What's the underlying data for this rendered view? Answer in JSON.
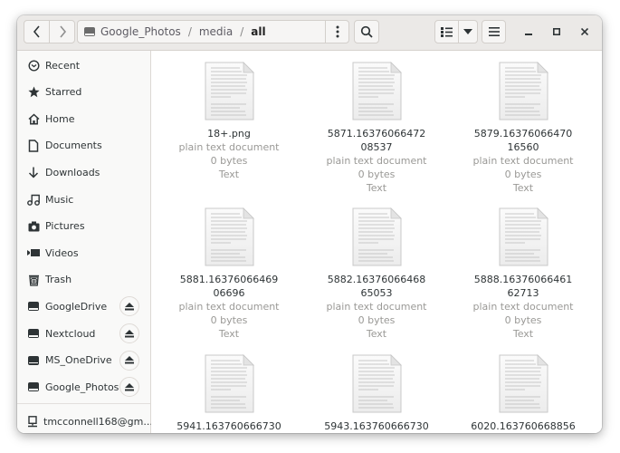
{
  "header": {
    "back_icon": "chevron-left-icon",
    "forward_icon": "chevron-right-icon",
    "path": [
      {
        "label": "Google_Photos",
        "icon": "drive-icon"
      },
      {
        "label": "media"
      },
      {
        "label": "all"
      }
    ],
    "path_separator": "/",
    "more_icon": "vertical-dots-icon",
    "search_icon": "search-icon",
    "view_icon": "list-view-icon",
    "view_dropdown_icon": "caret-down-icon",
    "menu_icon": "hamburger-icon",
    "minimize_icon": "minimize-icon",
    "maximize_icon": "maximize-icon",
    "close_icon": "close-icon"
  },
  "sidebar": {
    "items": [
      {
        "label": "Recent",
        "icon": "clock-icon"
      },
      {
        "label": "Starred",
        "icon": "star-icon"
      },
      {
        "label": "Home",
        "icon": "home-icon"
      },
      {
        "label": "Documents",
        "icon": "document-icon"
      },
      {
        "label": "Downloads",
        "icon": "download-icon"
      },
      {
        "label": "Music",
        "icon": "music-icon"
      },
      {
        "label": "Pictures",
        "icon": "camera-icon"
      },
      {
        "label": "Videos",
        "icon": "video-icon"
      },
      {
        "label": "Trash",
        "icon": "trash-icon"
      }
    ],
    "mounts": [
      {
        "label": "GoogleDrive",
        "icon": "drive-icon",
        "eject": "eject-icon"
      },
      {
        "label": "Nextcloud",
        "icon": "drive-icon",
        "eject": "eject-icon"
      },
      {
        "label": "MS_OneDrive",
        "icon": "drive-icon",
        "eject": "eject-icon"
      },
      {
        "label": "Google_Photos",
        "icon": "drive-icon",
        "eject": "eject-icon"
      }
    ],
    "network": [
      {
        "label": "tmcconnell168@gm...",
        "icon": "network-computer-icon"
      }
    ]
  },
  "files": [
    {
      "name": "18+.png",
      "type": "plain text document",
      "size": "0 bytes",
      "kind": "Text"
    },
    {
      "name": "5871.1637606647208537",
      "type": "plain text document",
      "size": "0 bytes",
      "kind": "Text"
    },
    {
      "name": "5879.1637606647016560",
      "type": "plain text document",
      "size": "0 bytes",
      "kind": "Text"
    },
    {
      "name": "5881.1637606646906696",
      "type": "plain text document",
      "size": "0 bytes",
      "kind": "Text"
    },
    {
      "name": "5882.1637606646865053",
      "type": "plain text document",
      "size": "0 bytes",
      "kind": "Text"
    },
    {
      "name": "5888.1637606646162713",
      "type": "plain text document",
      "size": "0 bytes",
      "kind": "Text"
    },
    {
      "name": "5941.163760666730",
      "type": "",
      "size": "",
      "kind": ""
    },
    {
      "name": "5943.163760666730",
      "type": "",
      "size": "",
      "kind": ""
    },
    {
      "name": "6020.163760668856",
      "type": "",
      "size": "",
      "kind": ""
    }
  ]
}
